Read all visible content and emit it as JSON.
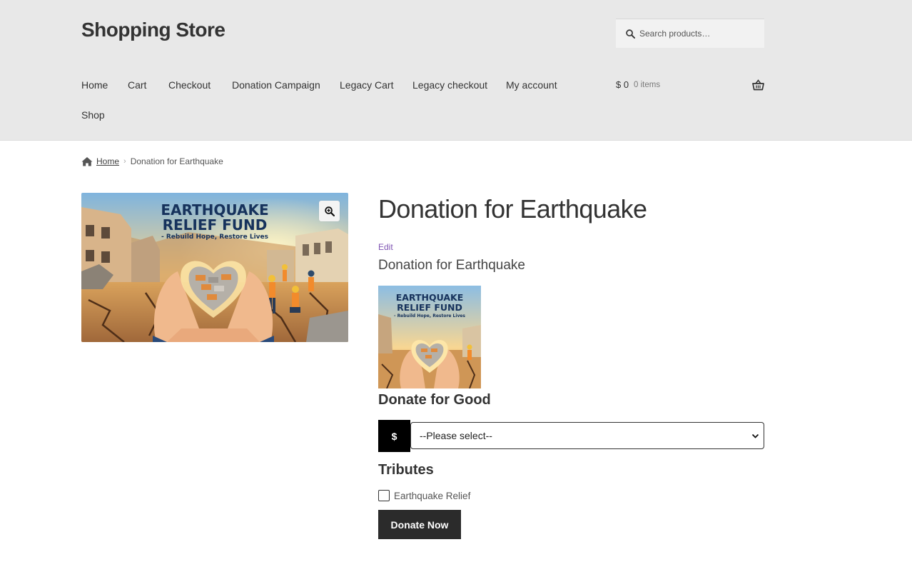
{
  "site": {
    "title": "Shopping Store"
  },
  "search": {
    "placeholder": "Search products…"
  },
  "nav": {
    "items": [
      "Home",
      "Cart",
      "Checkout",
      "Donation Campaign",
      "Legacy Cart",
      "Legacy checkout",
      "My account",
      "Shop"
    ]
  },
  "cart": {
    "total": "$ 0",
    "count": "0 items"
  },
  "breadcrumb": {
    "home": "Home",
    "separator": "›",
    "current": "Donation for Earthquake"
  },
  "product": {
    "title": "Donation for Earthquake",
    "edit_label": "Edit",
    "subtitle": "Donation for Earthquake",
    "image": {
      "headline_1": "EARTHQUAKE",
      "headline_2": "RELIEF FUND",
      "tagline": "- Rebuild Hope, Restore Lives"
    }
  },
  "donation": {
    "heading": "Donate for Good",
    "currency_symbol": "$",
    "amount_selected": "--Please select--",
    "tributes_heading": "Tributes",
    "tribute_option": "Earthquake Relief",
    "tribute_checked": false,
    "button_label": "Donate Now"
  },
  "colors": {
    "header_bg": "#e8e8e8",
    "edit_link": "#7f54b3",
    "button_bg": "#2b2b2b",
    "currency_bg": "#000000"
  }
}
